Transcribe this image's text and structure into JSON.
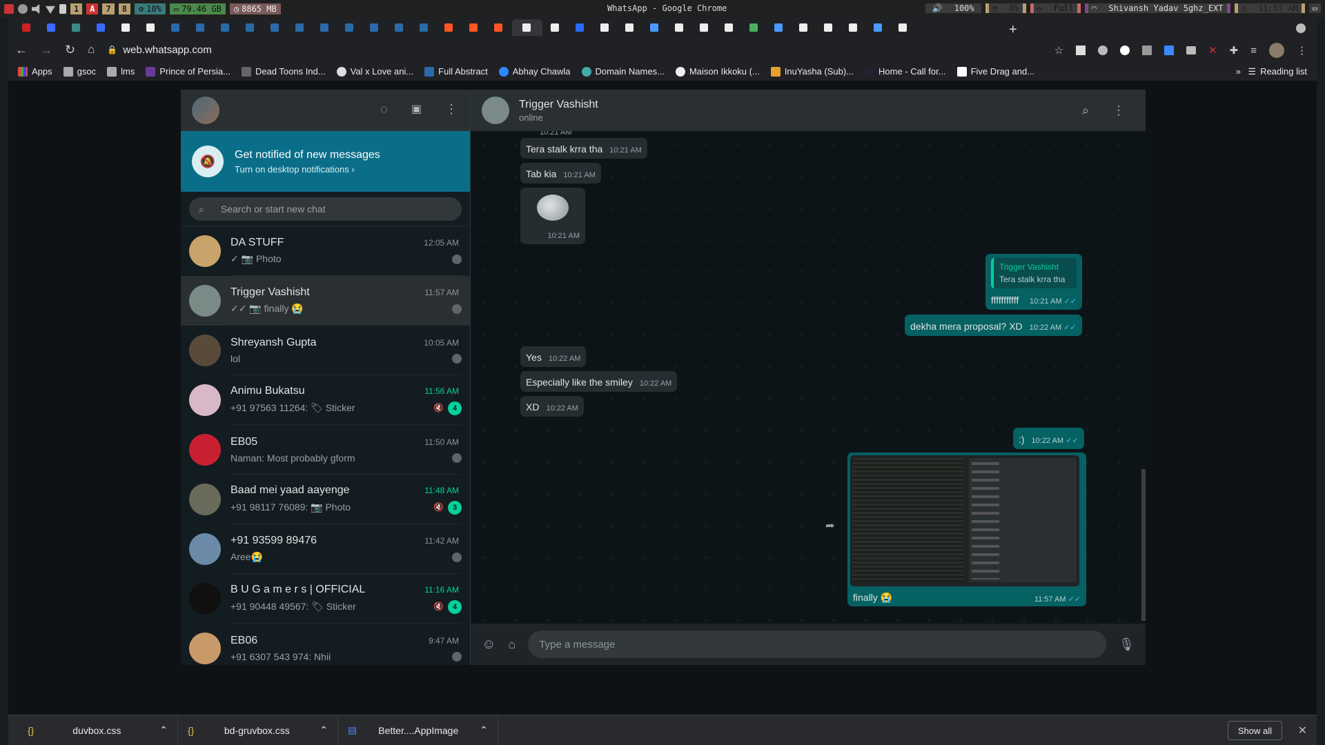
{
  "sysbar": {
    "workspaces": [
      "1",
      "A",
      "7",
      "8"
    ],
    "cpu": "10%",
    "disk": "79.46 GB",
    "mem": "8865 MB",
    "title": "WhatsApp - Google Chrome",
    "volume": "100%",
    "battery": "0%",
    "brightness": "Full",
    "wifi": "Shivansh Yadav 5ghz_EXT",
    "clock": "11:57 AM"
  },
  "browser": {
    "url": "web.whatsapp.com",
    "bookmarks": [
      "Apps",
      "gsoc",
      "lms",
      "Prince of Persia...",
      "Dead Toons Ind...",
      "Val x Love ani...",
      "Full Abstract",
      "Abhay Chawla",
      "Domain Names...",
      "Maison Ikkoku (...",
      "InuYasha (Sub)...",
      "Home - Call for...",
      "Five Drag and..."
    ],
    "reading_list": "Reading list",
    "more": "»"
  },
  "sidebar": {
    "notif_title": "Get notified of new messages",
    "notif_sub": "Turn on desktop notifications ›",
    "search_placeholder": "Search or start new chat",
    "chats": [
      {
        "name": "DA STUFF",
        "time": "12:05 AM",
        "preview": "✓ 📷 Photo",
        "color": "#c8a46a"
      },
      {
        "name": "Trigger Vashisht",
        "time": "11:57 AM",
        "preview": "✓✓ 📷 finally 😭",
        "color": "#7a8a86"
      },
      {
        "name": "Shreyansh Gupta",
        "time": "10:05 AM",
        "preview": "lol",
        "color": "#5a4a3a"
      },
      {
        "name": "Animu Bukatsu",
        "time": "11:56 AM",
        "preview": "+91 97563 11264: 🏷 Sticker",
        "badge": "4",
        "color": "#d8b8c8"
      },
      {
        "name": "EB05",
        "time": "11:50 AM",
        "preview": "Naman: Most probably gform",
        "color": "#c82030"
      },
      {
        "name": "Baad mei yaad aayenge",
        "time": "11:48 AM",
        "preview": "+91 98117 76089: 📷 Photo",
        "badge": "3",
        "color": "#6a6a5a"
      },
      {
        "name": "+91 93599 89476",
        "time": "11:42 AM",
        "preview": "Aree😭",
        "color": "#6a8aa8"
      },
      {
        "name": "B U G a m e r s | OFFICIAL",
        "time": "11:16 AM",
        "preview": "+91 90448 49567: 🏷 Sticker",
        "badge": "4",
        "color": "#101010"
      },
      {
        "name": "EB06",
        "time": "9:47 AM",
        "preview": "+91 6307 543 974: Nhii",
        "color": "#c89a6a"
      }
    ]
  },
  "conversation": {
    "name": "Trigger Vashisht",
    "status": "online",
    "messages": [
      {
        "text": "Tera stalk krra tha",
        "time": "10:21 AM"
      },
      {
        "text": "Tab kia",
        "time": "10:21 AM"
      },
      {
        "text": "",
        "time": "10:21 AM"
      },
      {
        "quote_name": "Trigger Vashisht",
        "quote_text": "Tera stalk krra tha",
        "text": "fffffffffff",
        "time": "10:21 AM"
      },
      {
        "text": "dekha mera proposal? XD",
        "time": "10:22 AM"
      },
      {
        "text": "Yes",
        "time": "10:22 AM"
      },
      {
        "text": "Especially like the smiley",
        "time": "10:22 AM"
      },
      {
        "text": "XD",
        "time": "10:22 AM"
      },
      {
        "text": ":)",
        "time": "10:22 AM"
      },
      {
        "text": "finally 😭",
        "time": "11:57 AM"
      }
    ],
    "input_placeholder": "Type a message",
    "partial_time": "10:21 AM"
  },
  "downloads": {
    "items": [
      "duvbox.css",
      "bd-gruvbox.css",
      "Better....AppImage"
    ],
    "show_all": "Show all"
  },
  "colors": {
    "accent": "#06cf9c",
    "sent_bubble": "#056162",
    "recv_bubble": "#262d31",
    "notif_banner": "#0b6e88"
  }
}
